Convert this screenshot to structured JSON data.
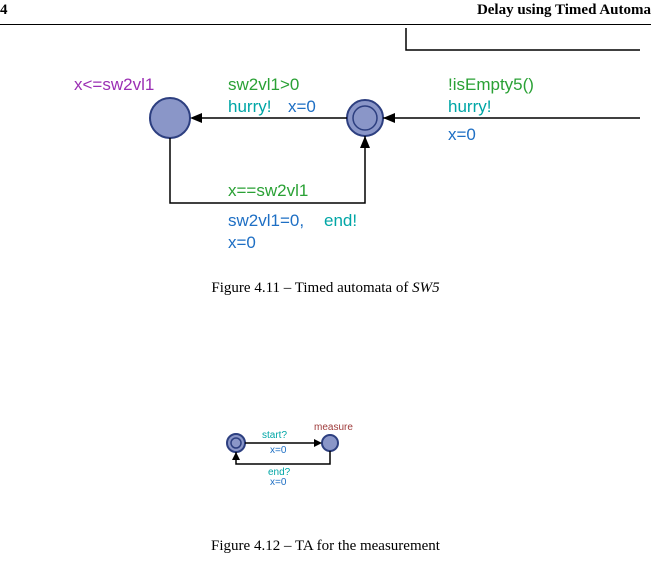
{
  "header": {
    "page_left": "4",
    "page_right": "Delay using Timed Automa"
  },
  "figure1": {
    "caption_prefix": "Figure 4.11 – Timed automata of ",
    "caption_object": "SW5",
    "invariant": "x<=sw2vl1",
    "top_guard": "sw2vl1>0",
    "top_sync": "hurry!",
    "top_reset": "x=0",
    "right_guard": "!isEmpty5()",
    "right_sync": "hurry!",
    "right_reset": "x=0",
    "front_frag": "",
    "bottom_guard": "x==sw2vl1",
    "bottom_assign": "sw2vl1=0,",
    "bottom_sync": "end!",
    "bottom_reset": "x=0"
  },
  "figure2": {
    "caption": "Figure 4.12 – TA for the measurement",
    "top_sync": "start?",
    "top_reset": "x=0",
    "right_label": "measure",
    "bottom_sync": "end?",
    "bottom_reset": "x=0"
  }
}
